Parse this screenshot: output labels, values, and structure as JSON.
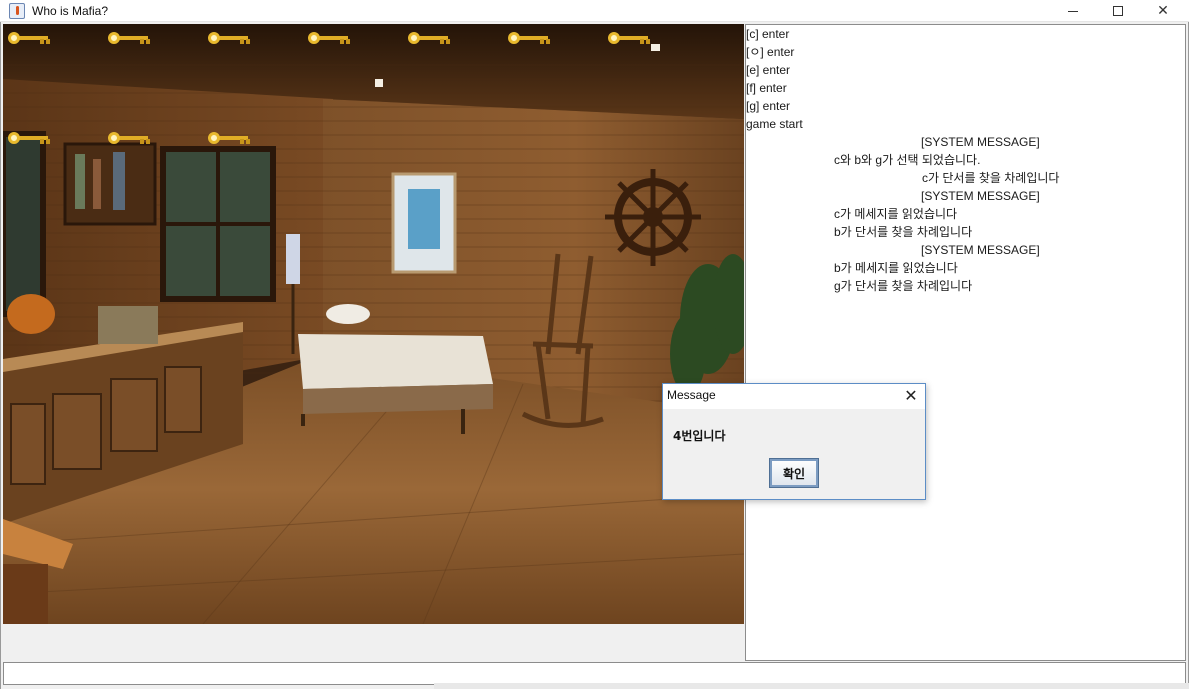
{
  "window": {
    "title": "Who is Mafia?",
    "close_glyph": "✕"
  },
  "scene": {
    "description_icons": [
      "key-icon"
    ],
    "key_count": 10
  },
  "log": {
    "lines": [
      "[c] enter",
      "[ㅇ] enter",
      "[e] enter",
      "[f] enter",
      "[g] enter",
      "game start",
      "[SYSTEM MESSAGE]",
      "c와 b와 g가 선택 되었습니다.",
      "c가 단서를 찾을 차례입니다",
      "[SYSTEM MESSAGE]",
      "c가 메세지를 읽었습니다",
      "b가 단서를 찾을 차례입니다",
      "[SYSTEM MESSAGE]",
      "b가 메세지를 읽었습니다",
      "g가 단서를 찾을 차례입니다"
    ]
  },
  "input": {
    "value": ""
  },
  "dialog": {
    "title": "Message",
    "message": "4번입니다",
    "ok_label": "확인",
    "close_glyph": "✕"
  },
  "colors": {
    "dialog_border": "#5c8dc6",
    "key_gold": "#e0ad25",
    "wood": "#8a5a2e"
  }
}
